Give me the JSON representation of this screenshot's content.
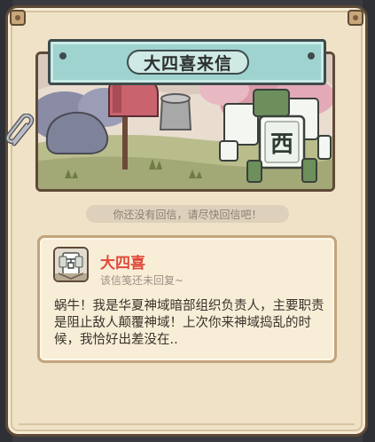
{
  "letter": {
    "title": "大四喜来信",
    "hint": "你还没有回信，请尽快回信吧！",
    "sender": {
      "name": "大四喜",
      "status": "该信笺还未回复~",
      "avatar_icon": "mahjong-tile-icon"
    },
    "message": "蜗牛！我是华夏神域暗部组织负责人，主要职责是阻止敌人颠覆神域！上次你来神域捣乱的时候，我恰好出差没在..",
    "illustration_glyph": "西"
  },
  "colors": {
    "panel_bg": "#efe2c7",
    "banner_teal": "#9fd3cf",
    "sender_red": "#e04a3a",
    "border_brown": "#5e4a36"
  }
}
